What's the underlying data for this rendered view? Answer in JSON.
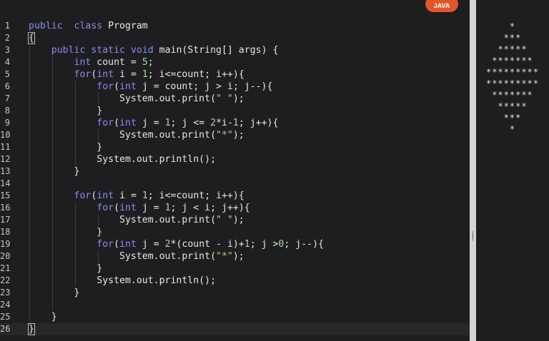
{
  "language_badge": "JAVA",
  "editor": {
    "current_line": 26,
    "lines": [
      {
        "n": "1",
        "t": [
          [
            "kw",
            "public"
          ],
          [
            "",
            "  "
          ],
          [
            "kw",
            "class"
          ],
          [
            "",
            " Program"
          ]
        ]
      },
      {
        "n": "2",
        "t": [
          [
            "bm",
            "{"
          ]
        ]
      },
      {
        "n": "3",
        "t": [
          [
            "",
            "    "
          ],
          [
            "kw",
            "public"
          ],
          [
            "",
            " "
          ],
          [
            "kw",
            "static"
          ],
          [
            "",
            " "
          ],
          [
            "kw",
            "void"
          ],
          [
            "",
            " main(String[] args) {"
          ]
        ]
      },
      {
        "n": "4",
        "t": [
          [
            "",
            "        "
          ],
          [
            "kw",
            "int"
          ],
          [
            "",
            " count = "
          ],
          [
            "num",
            "5"
          ],
          [
            "",
            ";"
          ]
        ]
      },
      {
        "n": "5",
        "t": [
          [
            "",
            "        "
          ],
          [
            "kw",
            "for"
          ],
          [
            "",
            "("
          ],
          [
            "kw",
            "int"
          ],
          [
            "",
            " i = "
          ],
          [
            "num",
            "1"
          ],
          [
            "",
            "; i<=count; i++){"
          ]
        ]
      },
      {
        "n": "6",
        "t": [
          [
            "",
            "            "
          ],
          [
            "kw",
            "for"
          ],
          [
            "",
            "("
          ],
          [
            "kw",
            "int"
          ],
          [
            "",
            " j = count; j > i; j--){"
          ]
        ]
      },
      {
        "n": "7",
        "t": [
          [
            "",
            "                System.out.print("
          ],
          [
            "str",
            "\" \""
          ],
          [
            "",
            ");"
          ]
        ]
      },
      {
        "n": "8",
        "t": [
          [
            "",
            "            }"
          ]
        ]
      },
      {
        "n": "9",
        "t": [
          [
            "",
            "            "
          ],
          [
            "kw",
            "for"
          ],
          [
            "",
            "("
          ],
          [
            "kw",
            "int"
          ],
          [
            "",
            " j = "
          ],
          [
            "num",
            "1"
          ],
          [
            "",
            "; j <= "
          ],
          [
            "num",
            "2"
          ],
          [
            "",
            "*i-"
          ],
          [
            "num",
            "1"
          ],
          [
            "",
            "; j++){"
          ]
        ]
      },
      {
        "n": "10",
        "t": [
          [
            "",
            "                System.out.print("
          ],
          [
            "str",
            "\"*\""
          ],
          [
            "",
            ");"
          ]
        ]
      },
      {
        "n": "11",
        "t": [
          [
            "",
            "            }"
          ]
        ]
      },
      {
        "n": "12",
        "t": [
          [
            "",
            "            System.out.println();"
          ]
        ]
      },
      {
        "n": "13",
        "t": [
          [
            "",
            "        }"
          ]
        ]
      },
      {
        "n": "14",
        "t": []
      },
      {
        "n": "15",
        "t": [
          [
            "",
            "        "
          ],
          [
            "kw",
            "for"
          ],
          [
            "",
            "("
          ],
          [
            "kw",
            "int"
          ],
          [
            "",
            " i = "
          ],
          [
            "num",
            "1"
          ],
          [
            "",
            "; i<=count; i++){"
          ]
        ]
      },
      {
        "n": "16",
        "t": [
          [
            "",
            "            "
          ],
          [
            "kw",
            "for"
          ],
          [
            "",
            "("
          ],
          [
            "kw",
            "int"
          ],
          [
            "",
            " j = "
          ],
          [
            "num",
            "1"
          ],
          [
            "",
            "; j < i; j++){"
          ]
        ]
      },
      {
        "n": "17",
        "t": [
          [
            "",
            "                System.out.print("
          ],
          [
            "str",
            "\" \""
          ],
          [
            "",
            ");"
          ]
        ]
      },
      {
        "n": "18",
        "t": [
          [
            "",
            "            }"
          ]
        ]
      },
      {
        "n": "19",
        "t": [
          [
            "",
            "            "
          ],
          [
            "kw",
            "for"
          ],
          [
            "",
            "("
          ],
          [
            "kw",
            "int"
          ],
          [
            "",
            " j = "
          ],
          [
            "num",
            "2"
          ],
          [
            "",
            "*(count - i)+"
          ],
          [
            "num",
            "1"
          ],
          [
            "",
            "; j >"
          ],
          [
            "num",
            "0"
          ],
          [
            "",
            "; j--){"
          ]
        ]
      },
      {
        "n": "20",
        "t": [
          [
            "",
            "                System.out.print("
          ],
          [
            "str",
            "\"*\""
          ],
          [
            "",
            ");"
          ]
        ]
      },
      {
        "n": "21",
        "t": [
          [
            "",
            "            }"
          ]
        ]
      },
      {
        "n": "22",
        "t": [
          [
            "",
            "            System.out.println();"
          ]
        ]
      },
      {
        "n": "23",
        "t": [
          [
            "",
            "        }"
          ]
        ]
      },
      {
        "n": "24",
        "t": []
      },
      {
        "n": "25",
        "t": [
          [
            "",
            "    }"
          ]
        ]
      },
      {
        "n": "26",
        "t": [
          [
            "bm",
            "}"
          ]
        ]
      }
    ]
  },
  "output": {
    "lines": [
      "*",
      "***",
      "*****",
      "*******",
      "*********",
      "*********",
      "*******",
      "*****",
      "***",
      "*"
    ]
  }
}
